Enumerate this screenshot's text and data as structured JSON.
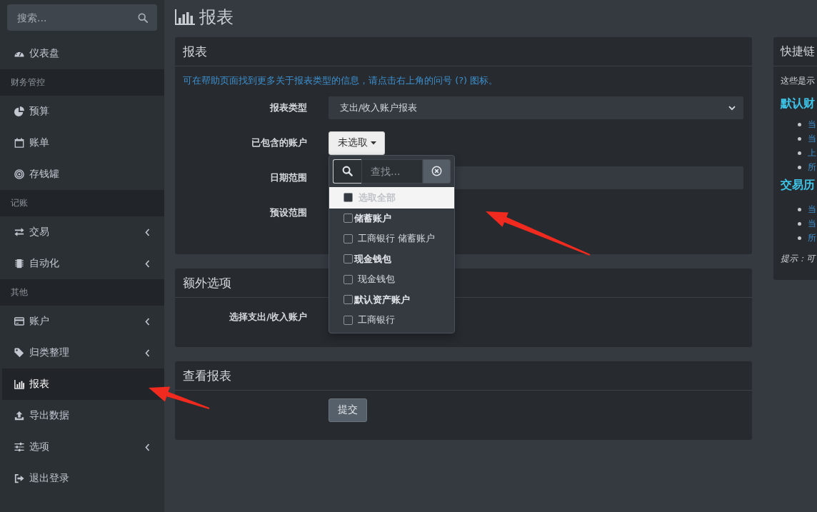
{
  "sidebar": {
    "search": {
      "placeholder": "搜索..."
    },
    "items": [
      {
        "kind": "link",
        "label": "仪表盘",
        "expandable": false,
        "selected": false
      },
      {
        "kind": "header",
        "label": "财务管控"
      },
      {
        "kind": "link",
        "label": "预算",
        "expandable": false,
        "selected": false
      },
      {
        "kind": "link",
        "label": "账单",
        "expandable": false,
        "selected": false
      },
      {
        "kind": "link",
        "label": "存钱罐",
        "expandable": false,
        "selected": false
      },
      {
        "kind": "header",
        "label": "记账"
      },
      {
        "kind": "link",
        "label": "交易",
        "expandable": true,
        "selected": false
      },
      {
        "kind": "link",
        "label": "自动化",
        "expandable": true,
        "selected": false
      },
      {
        "kind": "header",
        "label": "其他"
      },
      {
        "kind": "link",
        "label": "账户",
        "expandable": true,
        "selected": false
      },
      {
        "kind": "link",
        "label": "归类整理",
        "expandable": true,
        "selected": false
      },
      {
        "kind": "link",
        "label": "报表",
        "expandable": false,
        "selected": true
      },
      {
        "kind": "link",
        "label": "导出数据",
        "expandable": false,
        "selected": false
      },
      {
        "kind": "link",
        "label": "选项",
        "expandable": true,
        "selected": false
      },
      {
        "kind": "link",
        "label": "退出登录",
        "expandable": false,
        "selected": false
      }
    ]
  },
  "page_title": "报表",
  "report_card": {
    "title": "报表",
    "help_text": "可在帮助页面找到更多关于报表类型的信息，请点击右上角的问号 (?) 图标。",
    "fields": [
      {
        "kind": "select",
        "label": "报表类型",
        "value": "支出/收入账户报表"
      },
      {
        "kind": "multiselect",
        "label": "已包含的账户",
        "button_label": "未选取",
        "expanded": true,
        "search_placeholder": "查找...",
        "select_all": {
          "label": "选取全部",
          "checked": false,
          "highlighted": true
        },
        "groups": [
          {
            "label": "储蓄账户",
            "checked": false,
            "children": [
              {
                "label": "工商银行 储蓄账户",
                "checked": false
              }
            ]
          },
          {
            "label": "现金钱包",
            "checked": false,
            "children": [
              {
                "label": "现金钱包",
                "checked": false
              }
            ]
          },
          {
            "label": "默认资产账户",
            "checked": false,
            "children": [
              {
                "label": "工商银行",
                "checked": false
              }
            ]
          }
        ]
      },
      {
        "kind": "input",
        "label": "日期范围"
      },
      {
        "kind": "label",
        "label": "预设范围"
      }
    ]
  },
  "extra_options_card": {
    "title": "额外选项",
    "fields": [
      {
        "label": "选择支出/收入账户"
      }
    ]
  },
  "view_report_card": {
    "title": "查看报表",
    "submit_button": "提交"
  },
  "quick_links": {
    "title": "快捷链",
    "intro": "这些是示",
    "sections": [
      {
        "title": "默认财",
        "links": [
          "当",
          "当",
          "上",
          "所"
        ]
      },
      {
        "title": "交易历",
        "links": [
          "当",
          "当",
          "所"
        ]
      }
    ],
    "tip": "提示：可"
  },
  "annotations": [
    {
      "kind": "arrow"
    },
    {
      "kind": "arrow"
    }
  ]
}
